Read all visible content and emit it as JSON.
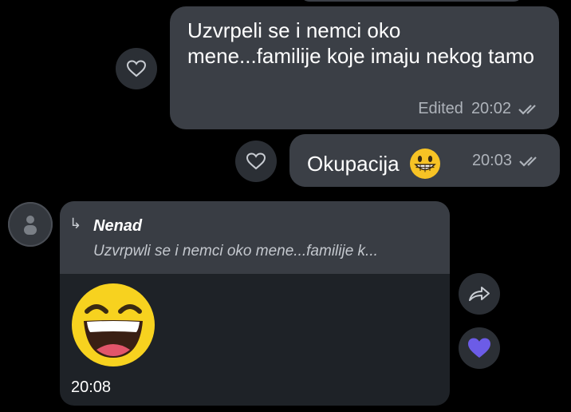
{
  "messages": {
    "outgoing_1": {
      "text": "Uzvrpeli se i nemci oko mene...familije koje imaju nekog tamo",
      "edited_label": "Edited",
      "time": "20:02",
      "status_icon": "double-check-icon"
    },
    "outgoing_2": {
      "text": "Okupacija",
      "emoji": "grinning-face-with-big-eyes",
      "time": "20:03",
      "status_icon": "double-check-icon"
    },
    "incoming_1": {
      "reply": {
        "arrow": "↳",
        "name": "Nenad",
        "snippet": "Uzvrpwli se i nemci oko mene...familije k..."
      },
      "sticker": "laughing-face",
      "time": "20:08"
    }
  },
  "actions": {
    "react_icon": "heart-outline-icon",
    "share_icon": "share-arrow-icon",
    "liked_icon": "heart-filled-icon"
  },
  "colors": {
    "background": "#000000",
    "outgoing_bubble": "#3b3f46",
    "incoming_bubble": "#1e2227",
    "reply_box": "#393d44",
    "meta_text": "#aeb3ba",
    "heart_filled": "#6c5ce7"
  }
}
